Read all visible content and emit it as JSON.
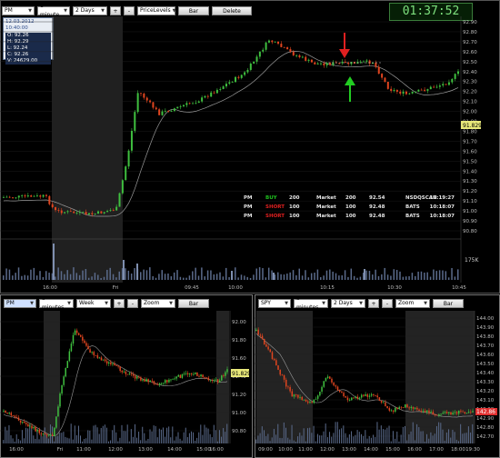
{
  "main": {
    "toolbar": {
      "symbol": "PM",
      "interval": "1 minute",
      "range": "2 Days",
      "plus": "+",
      "minus": "-",
      "study": "PriceLevels",
      "bar": "Bar",
      "delete_levels": "Delete Levels"
    },
    "clock": "01:37:52",
    "ohlc": {
      "stamp": "12.03.2012 10:40:00",
      "open": "O: 92.26",
      "high": "H: 92.29",
      "low": "L: 92.24",
      "close": "C: 92.26",
      "volume": "V: 24629.00"
    },
    "price_ticks": [
      "92.90",
      "92.80",
      "92.70",
      "92.60",
      "92.50",
      "92.40",
      "92.30",
      "92.20",
      "92.10",
      "92.00",
      "91.90",
      "91.80",
      "91.70",
      "91.60",
      "91.50",
      "91.40",
      "91.30",
      "91.20",
      "91.10",
      "91.00",
      "90.90",
      "90.80"
    ],
    "last_price": "91.829",
    "volume_label": "175K",
    "time_ticks": [
      "16:00",
      "Fri",
      "09:45",
      "10:00",
      "10:15",
      "10:30",
      "10:45"
    ],
    "orders": [
      {
        "sym": "PM",
        "side": "BUY",
        "qty": "200",
        "type": "Market",
        "filled": "200",
        "price": "92.54",
        "venue": "NSDQSCAN",
        "time": "10:19:27"
      },
      {
        "sym": "PM",
        "side": "SHORT",
        "qty": "100",
        "type": "Market",
        "filled": "100",
        "price": "92.48",
        "venue": "BATS",
        "time": "10:18:07"
      },
      {
        "sym": "PM",
        "side": "SHORT",
        "qty": "100",
        "type": "Market",
        "filled": "100",
        "price": "92.48",
        "venue": "BATS",
        "time": "10:18:07"
      }
    ]
  },
  "left": {
    "toolbar": {
      "symbol": "PM",
      "interval": "5 minutes",
      "range": "Week",
      "plus": "+",
      "minus": "-",
      "study": "Zoom",
      "bar": "Bar"
    },
    "price_ticks": [
      "92.00",
      "91.80",
      "91.60",
      "91.40",
      "91.20",
      "91.00",
      "90.80"
    ],
    "last_price": "91.829",
    "time_ticks": [
      "16:00",
      "Fri",
      "11:00",
      "12:00",
      "13:00",
      "14:00",
      "15:00",
      "16:00"
    ]
  },
  "right": {
    "toolbar": {
      "symbol": "SPY",
      "interval": "5 minutes",
      "range": "2 Days",
      "plus": "+",
      "minus": "-",
      "study": "Zoom",
      "bar": "Bar"
    },
    "price_ticks": [
      "144.00",
      "143.90",
      "143.80",
      "143.70",
      "143.60",
      "143.50",
      "143.40",
      "143.30",
      "143.20",
      "143.10",
      "143.00",
      "142.90",
      "142.80",
      "142.70"
    ],
    "last_price": "142.86",
    "time_ticks": [
      "09:00",
      "10:00",
      "11:00",
      "12:00",
      "13:00",
      "14:00",
      "15:00",
      "16:00",
      "17:00",
      "18:00",
      "19:30"
    ]
  },
  "colors": {
    "up": "#3fbf3f",
    "down": "#e0451f",
    "buy": "#1fbf1f",
    "short": "#e02020",
    "session_shade": "#3a3a3a",
    "volume": "#5a6a8a",
    "ma_line": "#9a9a9a",
    "arrow_down": "#e02020",
    "arrow_up": "#22cc22"
  }
}
